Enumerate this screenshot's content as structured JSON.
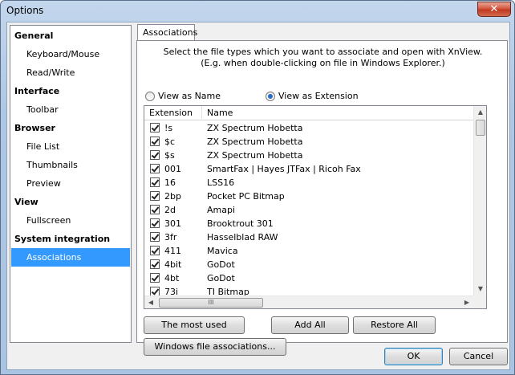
{
  "window": {
    "title": "Options",
    "close_glyph": "✕"
  },
  "nav": {
    "items": [
      {
        "label": "General",
        "type": "head"
      },
      {
        "label": "Keyboard/Mouse",
        "type": "item"
      },
      {
        "label": "Read/Write",
        "type": "item"
      },
      {
        "label": "Interface",
        "type": "head"
      },
      {
        "label": "Toolbar",
        "type": "item"
      },
      {
        "label": "Browser",
        "type": "head"
      },
      {
        "label": "File List",
        "type": "item"
      },
      {
        "label": "Thumbnails",
        "type": "item"
      },
      {
        "label": "Preview",
        "type": "item"
      },
      {
        "label": "View",
        "type": "head"
      },
      {
        "label": "Fullscreen",
        "type": "item"
      },
      {
        "label": "System integration",
        "type": "head"
      },
      {
        "label": "Associations",
        "type": "item",
        "selected": true
      }
    ]
  },
  "tab": {
    "label": "Associations"
  },
  "description": {
    "line1": "Select the file types which you want to associate and open with XnView.",
    "line2": "(E.g. when double-clicking on file in Windows Explorer.)"
  },
  "view_mode": {
    "by_name_label": "View as Name",
    "by_extension_label": "View as Extension",
    "selected": "extension"
  },
  "list": {
    "columns": [
      "Extension",
      "Name"
    ],
    "rows": [
      {
        "ext": "!s",
        "name": "ZX Spectrum Hobetta",
        "checked": true
      },
      {
        "ext": "$c",
        "name": "ZX Spectrum Hobetta",
        "checked": true
      },
      {
        "ext": "$s",
        "name": "ZX Spectrum Hobetta",
        "checked": true
      },
      {
        "ext": "001",
        "name": "SmartFax | Hayes JTFax | Ricoh Fax",
        "checked": true
      },
      {
        "ext": "16",
        "name": "LSS16",
        "checked": true
      },
      {
        "ext": "2bp",
        "name": "Pocket PC Bitmap",
        "checked": true
      },
      {
        "ext": "2d",
        "name": "Amapi",
        "checked": true
      },
      {
        "ext": "301",
        "name": "Brooktrout 301",
        "checked": true
      },
      {
        "ext": "3fr",
        "name": "Hasselblad RAW",
        "checked": true
      },
      {
        "ext": "411",
        "name": "Mavica",
        "checked": true
      },
      {
        "ext": "4bit",
        "name": "GoDot",
        "checked": true
      },
      {
        "ext": "4bt",
        "name": "GoDot",
        "checked": true
      },
      {
        "ext": "73i",
        "name": "TI Bitmap",
        "checked": true
      }
    ],
    "hscroll_grip": "III"
  },
  "buttons": {
    "most_used": "The most used",
    "add_all": "Add All",
    "restore_all": "Restore All",
    "windows_assoc": "Windows file associations...",
    "ok": "OK",
    "cancel": "Cancel"
  }
}
